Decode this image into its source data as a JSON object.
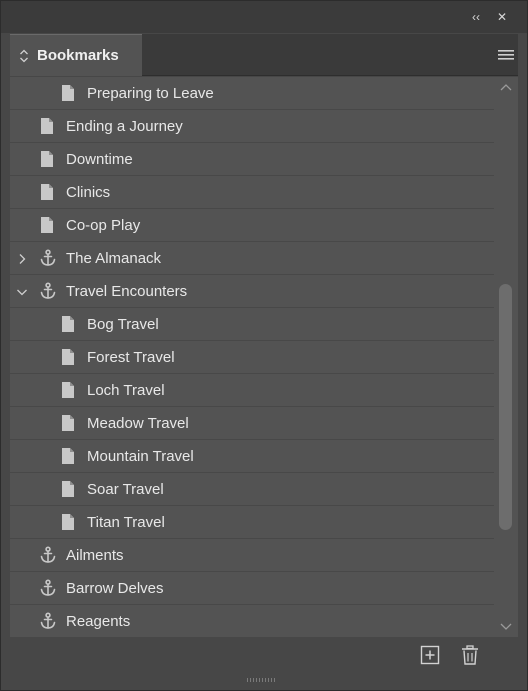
{
  "window": {
    "collapse_glyph": "‹‹",
    "close_glyph": "✕"
  },
  "panel": {
    "tab_title": "Bookmarks",
    "colors": {
      "background": "#535353",
      "chrome": "#3b3b3b",
      "text": "#e8e8e8",
      "icon": "#c8c8c8"
    }
  },
  "bookmarks": [
    {
      "label": "Preparing to Leave",
      "icon": "page-icon",
      "level": 2,
      "twisty": "none"
    },
    {
      "label": "Ending a Journey",
      "icon": "page-icon",
      "level": 1,
      "twisty": "none"
    },
    {
      "label": "Downtime",
      "icon": "page-icon",
      "level": 1,
      "twisty": "none"
    },
    {
      "label": "Clinics",
      "icon": "page-icon",
      "level": 1,
      "twisty": "none"
    },
    {
      "label": "Co-op Play",
      "icon": "page-icon",
      "level": 1,
      "twisty": "none"
    },
    {
      "label": "The Almanack",
      "icon": "anchor-icon",
      "level": 1,
      "twisty": "collapsed"
    },
    {
      "label": "Travel Encounters",
      "icon": "anchor-icon",
      "level": 1,
      "twisty": "expanded"
    },
    {
      "label": "Bog Travel",
      "icon": "page-icon",
      "level": 2,
      "twisty": "none"
    },
    {
      "label": "Forest Travel",
      "icon": "page-icon",
      "level": 2,
      "twisty": "none"
    },
    {
      "label": "Loch Travel",
      "icon": "page-icon",
      "level": 2,
      "twisty": "none"
    },
    {
      "label": "Meadow Travel",
      "icon": "page-icon",
      "level": 2,
      "twisty": "none"
    },
    {
      "label": "Mountain Travel",
      "icon": "page-icon",
      "level": 2,
      "twisty": "none"
    },
    {
      "label": "Soar Travel",
      "icon": "page-icon",
      "level": 2,
      "twisty": "none"
    },
    {
      "label": "Titan Travel",
      "icon": "page-icon",
      "level": 2,
      "twisty": "none"
    },
    {
      "label": "Ailments",
      "icon": "anchor-icon",
      "level": 1,
      "twisty": "none"
    },
    {
      "label": "Barrow Delves",
      "icon": "anchor-icon",
      "level": 1,
      "twisty": "none"
    },
    {
      "label": "Reagents",
      "icon": "anchor-icon",
      "level": 1,
      "twisty": "none"
    }
  ],
  "scrollbar": {
    "position_fraction": 0.68
  },
  "footer": {
    "buttons": [
      {
        "icon": "new-bookmark-icon"
      },
      {
        "icon": "trash-icon"
      }
    ]
  }
}
